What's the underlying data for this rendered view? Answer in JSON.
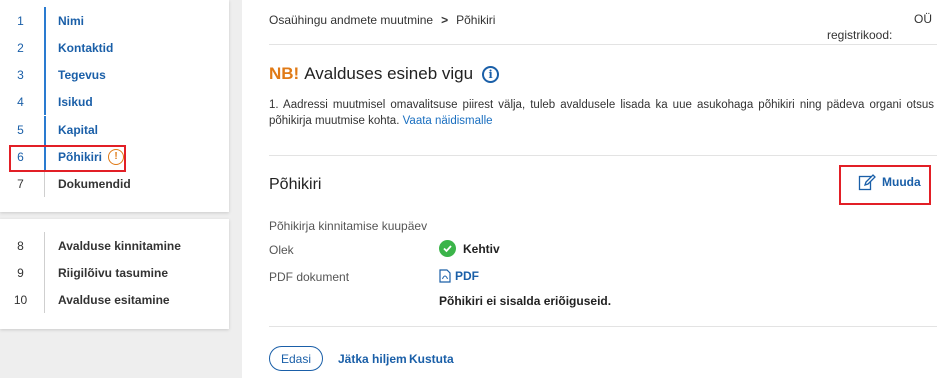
{
  "sidebar": {
    "steps_main": [
      {
        "num": "1",
        "label": "Nimi"
      },
      {
        "num": "2",
        "label": "Kontaktid"
      },
      {
        "num": "3",
        "label": "Tegevus"
      },
      {
        "num": "4",
        "label": "Isikud"
      },
      {
        "num": "5",
        "label": "Kapital"
      },
      {
        "num": "6",
        "label": "Põhikiri"
      },
      {
        "num": "7",
        "label": "Dokumendid"
      }
    ],
    "steps_final": [
      {
        "num": "8",
        "label": "Avalduse kinnitamine"
      },
      {
        "num": "9",
        "label": "Riigilõivu tasumine"
      },
      {
        "num": "10",
        "label": "Avalduse esitamine"
      }
    ],
    "warning_glyph": "!"
  },
  "header": {
    "breadcrumb_parent": "Osaühingu andmete muutmine",
    "breadcrumb_sep": ">",
    "breadcrumb_current": "Põhikiri",
    "company_type": "OÜ",
    "regcode_label": "registrikood:"
  },
  "notice": {
    "nb": "NB!",
    "title": "Avalduses esineb vigu",
    "info_glyph": "i",
    "item_text": "1. Aadressi muutmisel omavalitsuse piirest välja, tuleb avaldusele lisada ka uue asukohaga põhikiri ning pädeva organi otsus põhikirja muutmise kohta.",
    "item_link": "Vaata näidismalle"
  },
  "section": {
    "title": "Põhikiri",
    "edit_label": "Muuda",
    "fields": {
      "date_label": "Põhikirja kinnitamise kuupäev",
      "status_label": "Olek",
      "status_value": "Kehtiv",
      "pdf_label": "PDF dokument",
      "pdf_value": "PDF",
      "note": "Põhikiri ei sisalda eriõiguseid."
    }
  },
  "actions": {
    "next": "Edasi",
    "later": "Jätka hiljem",
    "delete": "Kustuta"
  },
  "colors": {
    "accent": "#1a5fa8",
    "warning": "#e07a16",
    "highlight": "#e21f26",
    "success": "#3bb44a"
  }
}
